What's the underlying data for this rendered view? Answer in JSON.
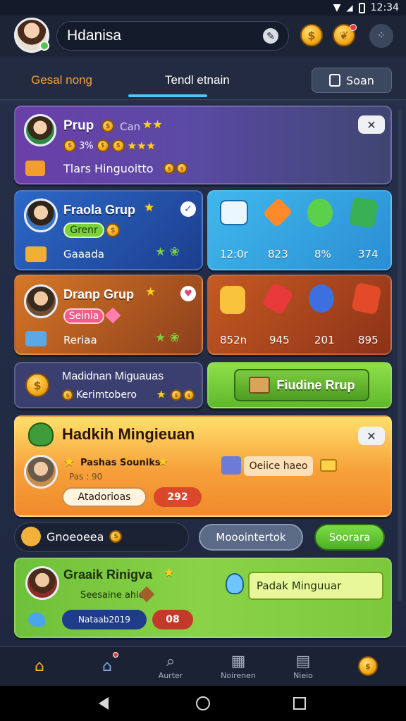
{
  "status_bar": {
    "time": "12:34"
  },
  "header": {
    "search_value": "Hdanisa"
  },
  "tabs": {
    "left": "Gesal nong",
    "center": "Tendl etnain",
    "search_button": "Soan"
  },
  "cards": {
    "purple": {
      "title": "Prup",
      "sub": "Can",
      "row2": "3%",
      "footer": "Tlars Hinguoitto"
    },
    "blue": {
      "title": "Fraola Grup",
      "badge": "Grenr",
      "footer": "Gaaada",
      "tiles": [
        "12:0r",
        "823",
        "8%",
        "374"
      ]
    },
    "brown": {
      "title": "Dranp Grup",
      "badge": "Seinia",
      "footer": "Reriaa",
      "tiles": [
        "852n",
        "945",
        "201",
        "895"
      ]
    },
    "small": {
      "title": "Madidnan Miguauas",
      "sub": "Kerimtobero"
    },
    "green_btn": {
      "label": "Fiudine Rrup"
    },
    "orange": {
      "title": "Hadkih Mingieuan",
      "player": "Pashas Souniks",
      "sub": "Pas : 90",
      "tag": "Oeiice haeo",
      "pill1": "Atadorioas",
      "pill2": "292"
    },
    "chips": {
      "first": "Gnoeoeea",
      "second": "Mooointertok",
      "third": "Soorara"
    },
    "lime": {
      "title": "Graaik Rinigva",
      "sub": "Seesaine ahio",
      "field": "Padak Minguuar",
      "pill1": "Nataab2019",
      "pill2": "08"
    }
  },
  "nav": {
    "item2": "Aurter",
    "item3": "Noirenen",
    "item4": "Nieio"
  },
  "colors": {
    "accent": "#4fc3f7",
    "gold": "#ffd21f",
    "green": "#7bd13a"
  }
}
